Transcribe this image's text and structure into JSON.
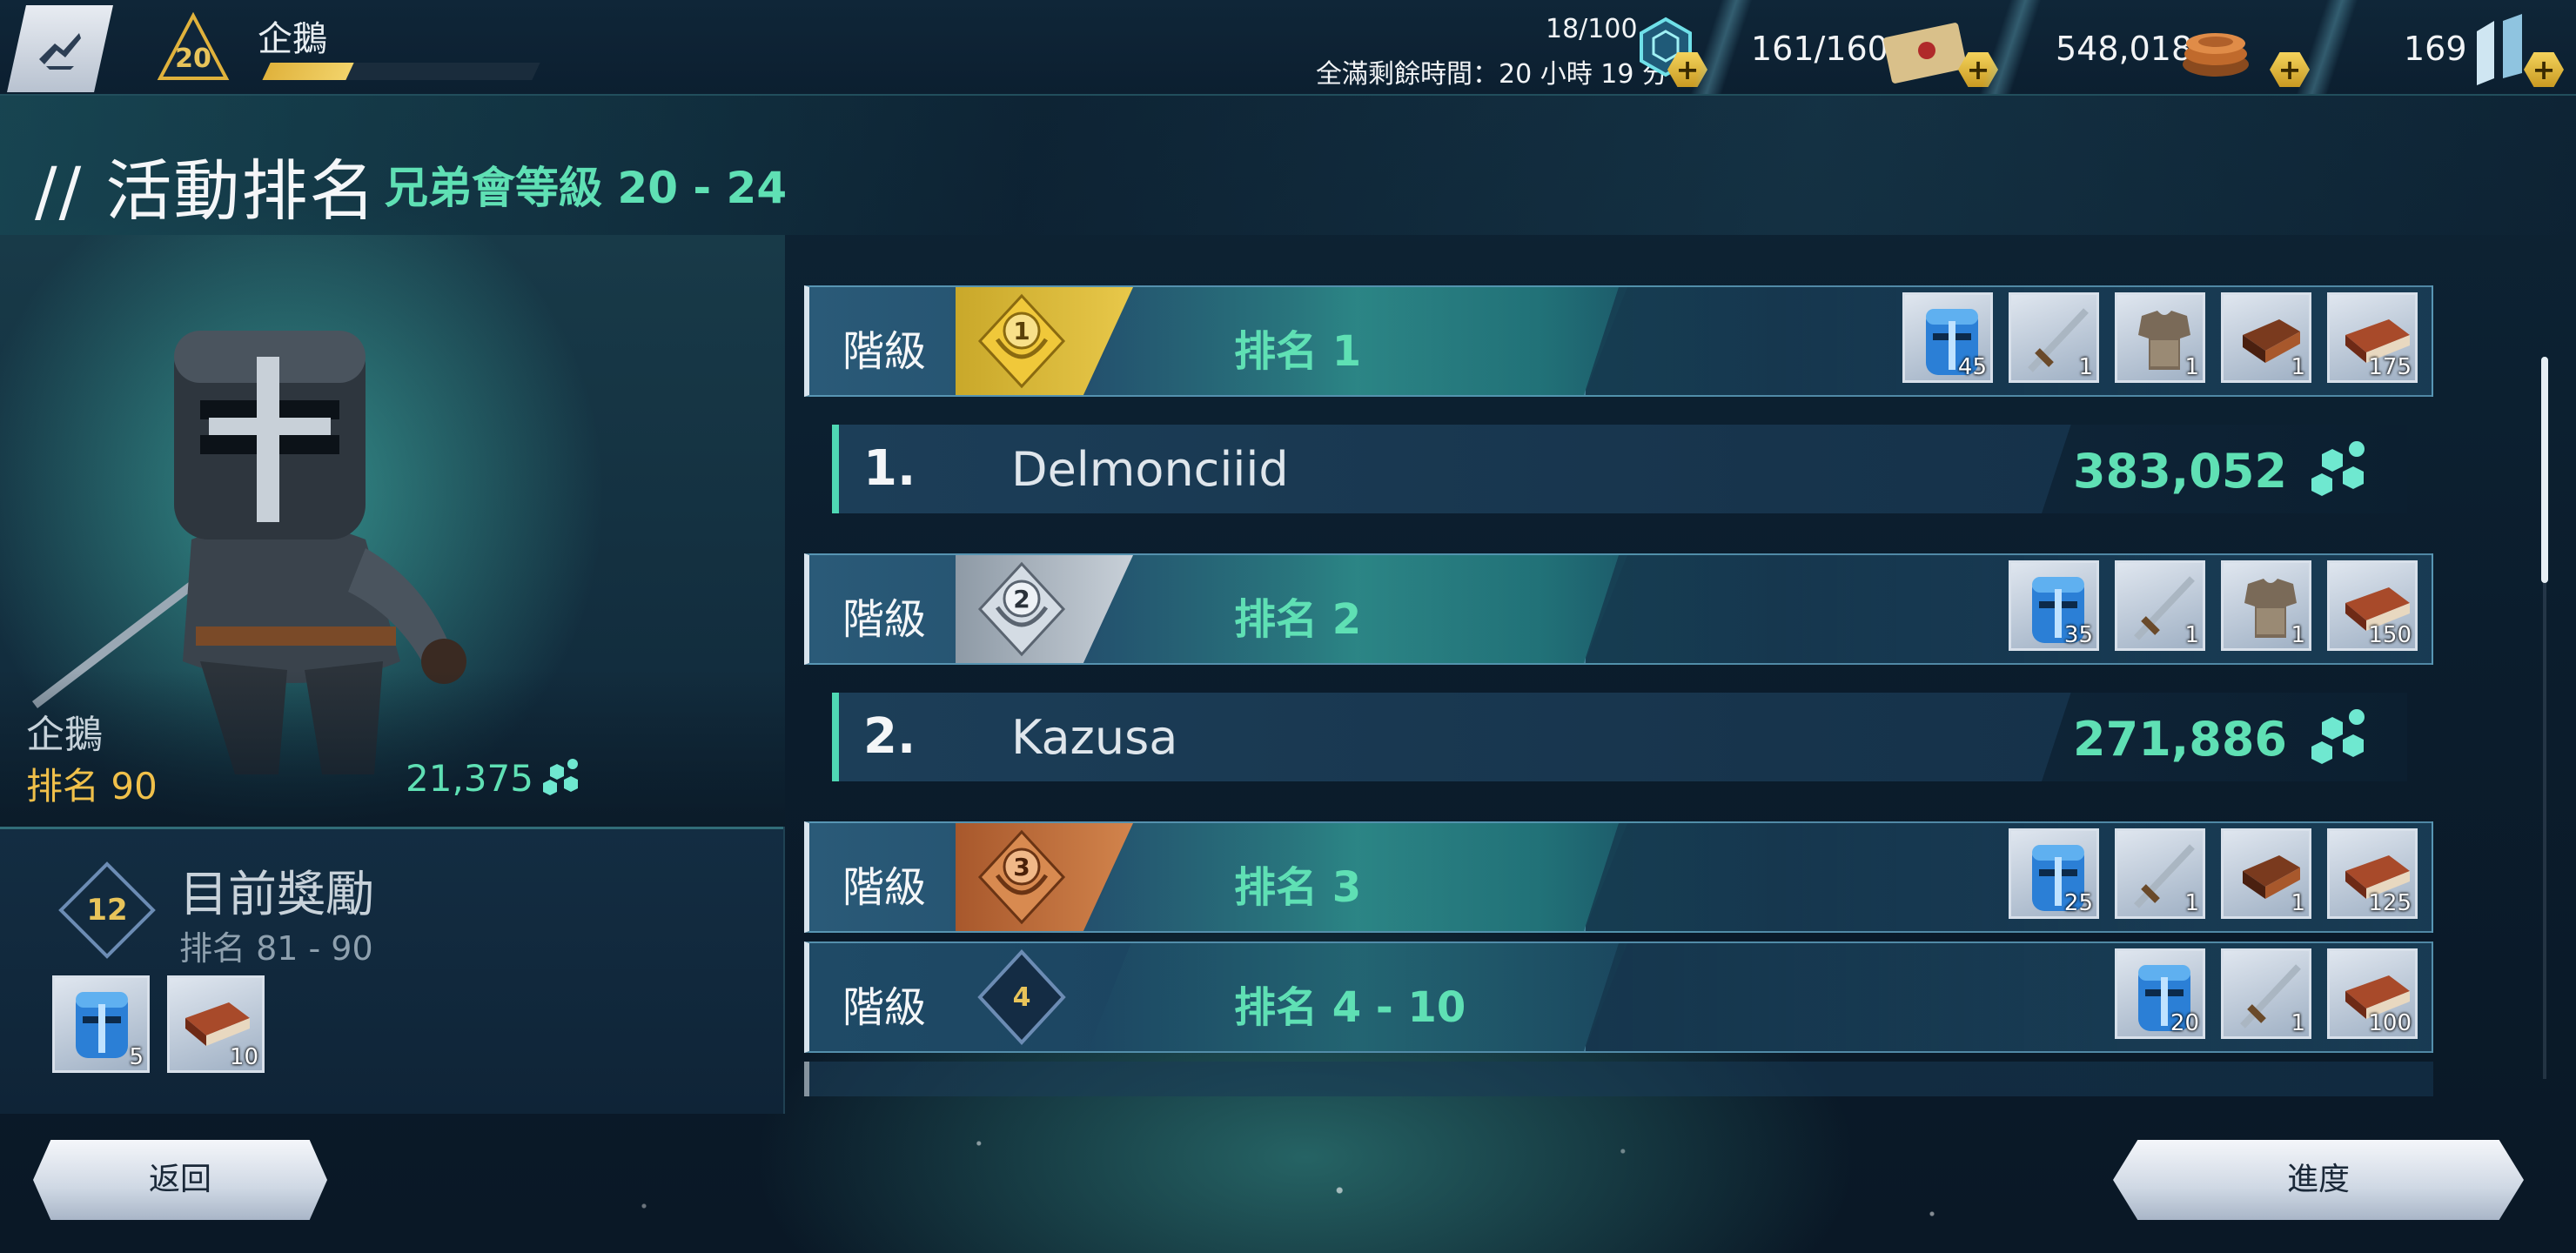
{
  "top_bar": {
    "player_level": "20",
    "player_name": "企鵝",
    "xp_fraction": 0.31,
    "energy": {
      "value": "18/100",
      "refill_text": "全滿剩餘時間：20 小時 19 分",
      "icon": "hex-energy-icon"
    },
    "letters": {
      "value": "161/160",
      "icon": "letter-icon"
    },
    "coins": {
      "value": "548,018",
      "icon": "coins-icon"
    },
    "helix": {
      "value": "169",
      "icon": "helix-crystal-icon"
    },
    "plus_label": "+"
  },
  "page": {
    "title": "// 活動排名",
    "subtitle": "兄弟會等級 20 - 24"
  },
  "player_card": {
    "name": "企鵝",
    "rank_label": "排名 90",
    "score": "21,375"
  },
  "current_reward": {
    "tier": "12",
    "title": "目前獎勵",
    "range": "排名 81 - 90",
    "items": [
      {
        "icon": "helmet-icon",
        "qty": "5"
      },
      {
        "icon": "book-icon",
        "qty": "10"
      }
    ]
  },
  "ranking": {
    "tier_label": "階級",
    "tiers": [
      {
        "tier": "1",
        "medal": "gold",
        "rank_label": "排名 1",
        "rewards": [
          {
            "icon": "helmet-icon",
            "qty": "45"
          },
          {
            "icon": "sword-icon",
            "qty": "1"
          },
          {
            "icon": "armor-icon",
            "qty": "1"
          },
          {
            "icon": "bracer-icon",
            "qty": "1"
          },
          {
            "icon": "book-icon",
            "qty": "175"
          }
        ]
      },
      {
        "tier": "2",
        "medal": "silver",
        "rank_label": "排名 2",
        "rewards": [
          {
            "icon": "helmet-icon",
            "qty": "35"
          },
          {
            "icon": "sword-icon",
            "qty": "1"
          },
          {
            "icon": "armor-icon",
            "qty": "1"
          },
          {
            "icon": "book-icon",
            "qty": "150"
          }
        ]
      },
      {
        "tier": "3",
        "medal": "bronze",
        "rank_label": "排名 3",
        "rewards": [
          {
            "icon": "helmet-icon",
            "qty": "25"
          },
          {
            "icon": "sword-icon",
            "qty": "1"
          },
          {
            "icon": "bracer-icon",
            "qty": "1"
          },
          {
            "icon": "book-icon",
            "qty": "125"
          }
        ]
      },
      {
        "tier": "4",
        "medal": "diamond",
        "rank_label": "排名 4 - 10",
        "rewards": [
          {
            "icon": "helmet-icon",
            "qty": "20"
          },
          {
            "icon": "sword-icon",
            "qty": "1"
          },
          {
            "icon": "book-icon",
            "qty": "100"
          }
        ]
      }
    ],
    "players": [
      {
        "position": "1.",
        "name": "Delmonciiid",
        "score": "383,052"
      },
      {
        "position": "2.",
        "name": "Kazusa",
        "score": "271,886"
      }
    ]
  },
  "buttons": {
    "back": "返回",
    "progress": "進度"
  },
  "colors": {
    "accent_green": "#5fe0b4",
    "gold": "#e8c45a",
    "panel_dark": "#0c1f30"
  }
}
